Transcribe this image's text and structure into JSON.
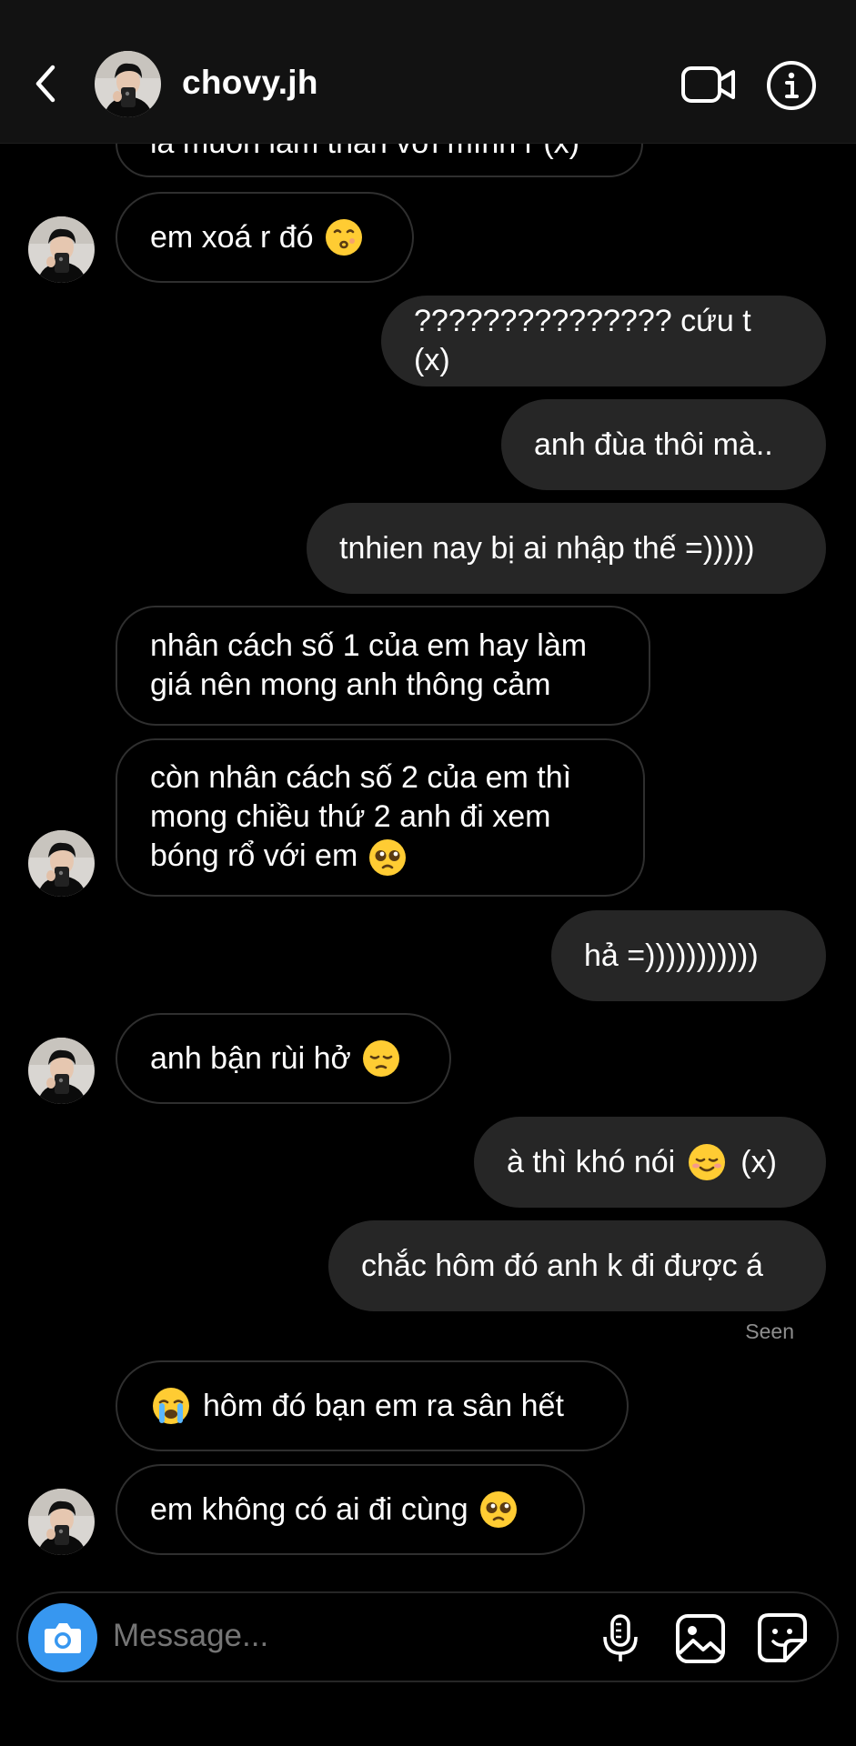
{
  "header": {
    "username": "chovy.jh"
  },
  "messages": [
    {
      "side": "in",
      "text": "là muốn làm thân với mình r (x)"
    },
    {
      "side": "in",
      "text": "em xoá r đó",
      "emoji": "kissing"
    },
    {
      "side": "out",
      "text": "??????????????? cứu t (x)"
    },
    {
      "side": "out",
      "text": "anh đùa thôi mà.."
    },
    {
      "side": "out",
      "text": "tnhien nay bị ai nhập thế =)))))"
    },
    {
      "side": "in",
      "text": "nhân cách số 1 của em hay làm\ngiá nên mong anh thông cảm"
    },
    {
      "side": "in",
      "text": "còn nhân cách số 2 của em thì\nmong chiều thứ 2 anh đi xem\nbóng rổ với em",
      "emoji": "pleading"
    },
    {
      "side": "out",
      "text": "hả =)))))))))))"
    },
    {
      "side": "in",
      "text": "anh bận rùi hở",
      "emoji": "pensive"
    },
    {
      "side": "out",
      "text_before": "à thì khó nói",
      "emoji": "relieved",
      "text_after": "(x)"
    },
    {
      "side": "out",
      "text": "chắc hôm đó anh k đi được á"
    },
    {
      "side": "in",
      "emoji_lead": "crying",
      "text": "hôm đó bạn em ra sân hết"
    },
    {
      "side": "in",
      "text": "em không có ai đi cùng",
      "emoji": "pleading"
    }
  ],
  "seen_label": "Seen",
  "composer": {
    "placeholder": "Message..."
  },
  "icons": [
    "back-chevron-icon",
    "video-call-icon",
    "info-icon",
    "camera-icon",
    "microphone-icon",
    "gallery-icon",
    "sticker-icon"
  ],
  "colors": {
    "accent": "#3797f0",
    "outgoing_bubble": "#262626",
    "incoming_border": "#2f2f2f",
    "header_bg": "#121212"
  }
}
